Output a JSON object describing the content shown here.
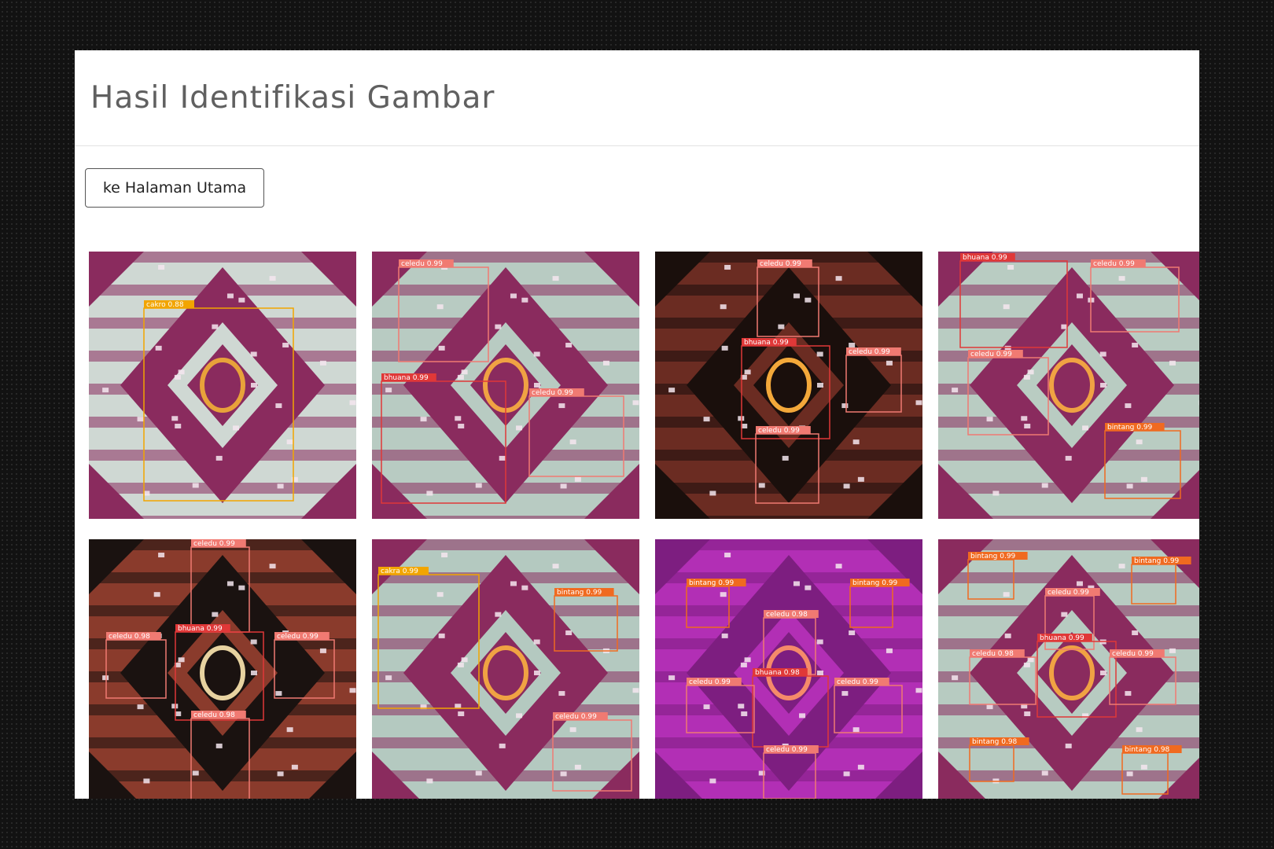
{
  "page": {
    "title": "Hasil Identifikasi Gambar"
  },
  "actions": {
    "home_button": "ke Halaman Utama"
  },
  "gallery": {
    "images": [
      {
        "base": "#cfd8d3",
        "motif": "#8a2b5e",
        "accent": "#e8a23a",
        "detections": [
          {
            "label": "cakro 0.88",
            "color": "#f2a500"
          }
        ]
      },
      {
        "base": "#b8cbc2",
        "motif": "#8a2b5e",
        "accent": "#f0a243",
        "detections": [
          {
            "label": "celedu 0.99",
            "color": "#f07a72"
          },
          {
            "label": "bhuana 0.99",
            "color": "#e03838"
          },
          {
            "label": "celedu 0.99",
            "color": "#f07a72"
          }
        ]
      },
      {
        "base": "#6b2c22",
        "motif": "#1a0f0c",
        "accent": "#f3a83a",
        "detections": [
          {
            "label": "celedu 0.99",
            "color": "#f07a72"
          },
          {
            "label": "bhuana 0.99",
            "color": "#e03838"
          },
          {
            "label": "celedu 0.99",
            "color": "#f07a72"
          },
          {
            "label": "celedu 0.99",
            "color": "#f07a72"
          }
        ]
      },
      {
        "base": "#b9ccc2",
        "motif": "#8a2b5e",
        "accent": "#f0a243",
        "detections": [
          {
            "label": "bhuana 0.99",
            "color": "#e03838"
          },
          {
            "label": "celedu 0.99",
            "color": "#f07a72"
          },
          {
            "label": "celedu 0.99",
            "color": "#f07a72"
          },
          {
            "label": "bintang 0.99",
            "color": "#f06a20"
          }
        ]
      },
      {
        "base": "#8a3b2c",
        "motif": "#1a1210",
        "accent": "#e7d2a0",
        "detections": [
          {
            "label": "celedu 0.99",
            "color": "#f07a72"
          },
          {
            "label": "bhuana 0.99",
            "color": "#e03838"
          },
          {
            "label": "celedu 0.98",
            "color": "#f07a72"
          },
          {
            "label": "celedu 0.99",
            "color": "#f07a72"
          },
          {
            "label": "celedu 0.98",
            "color": "#f07a72"
          }
        ]
      },
      {
        "base": "#b4c9c0",
        "motif": "#8a2b5e",
        "accent": "#f0a243",
        "detections": [
          {
            "label": "cakra 0.99",
            "color": "#f2a500"
          },
          {
            "label": "bintang 0.99",
            "color": "#f06a20"
          },
          {
            "label": "celedu 0.99",
            "color": "#f07a72"
          }
        ]
      },
      {
        "base": "#b22fb5",
        "motif": "#7d1e80",
        "accent": "#f58a6a",
        "detections": [
          {
            "label": "bintang 0.99",
            "color": "#f06a20"
          },
          {
            "label": "bintang 0.99",
            "color": "#f06a20"
          },
          {
            "label": "celedu 0.98",
            "color": "#f07a72"
          },
          {
            "label": "bhuana 0.98",
            "color": "#e03838"
          },
          {
            "label": "celedu 0.99",
            "color": "#f07a72"
          },
          {
            "label": "celedu 0.99",
            "color": "#f07a72"
          },
          {
            "label": "celedu 0.99",
            "color": "#f07a72"
          }
        ]
      },
      {
        "base": "#b7cbc1",
        "motif": "#8a2b5e",
        "accent": "#f0a243",
        "detections": [
          {
            "label": "bintang 0.99",
            "color": "#f06a20"
          },
          {
            "label": "bintang 0.99",
            "color": "#f06a20"
          },
          {
            "label": "celedu 0.99",
            "color": "#f07a72"
          },
          {
            "label": "bhuana 0.99",
            "color": "#e03838"
          },
          {
            "label": "celedu 0.98",
            "color": "#f07a72"
          },
          {
            "label": "celedu 0.99",
            "color": "#f07a72"
          },
          {
            "label": "bintang 0.98",
            "color": "#f06a20"
          },
          {
            "label": "bintang 0.98",
            "color": "#f06a20"
          }
        ]
      }
    ]
  }
}
